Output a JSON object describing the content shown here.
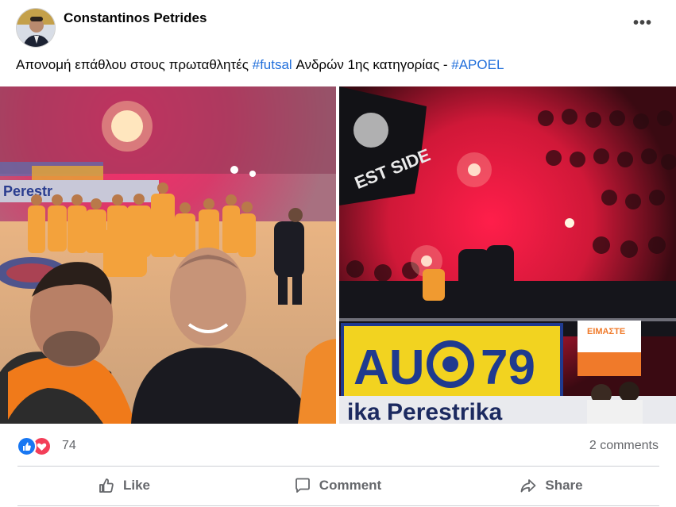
{
  "post": {
    "author": "Constantinos Petrides",
    "more_label": "•••",
    "text": {
      "prefix": "Απονομή επάθλου στους πρωταθλητές ",
      "hashtag1": "#futsal",
      "middle": " Ανδρών 1ης κατηγορίας - ",
      "hashtag2": "#APOEL"
    },
    "photos": {
      "left": {
        "banner_text": "Perestr"
      },
      "right": {
        "flag_text": "EST SIDE",
        "banner_left": "AU",
        "banner_right": "79",
        "orange_banner": "ΕΙΜΑΣΤΕ",
        "sponsor_text": "ika  Perestrika"
      }
    }
  },
  "stats": {
    "reaction_count": "74",
    "comments": "2 comments"
  },
  "actions": {
    "like": "Like",
    "comment": "Comment",
    "share": "Share"
  },
  "colors": {
    "hashtag": "#216fdb",
    "like_blue": "#1877f2",
    "love_red": "#f33e58",
    "muted_text": "#65676b"
  }
}
